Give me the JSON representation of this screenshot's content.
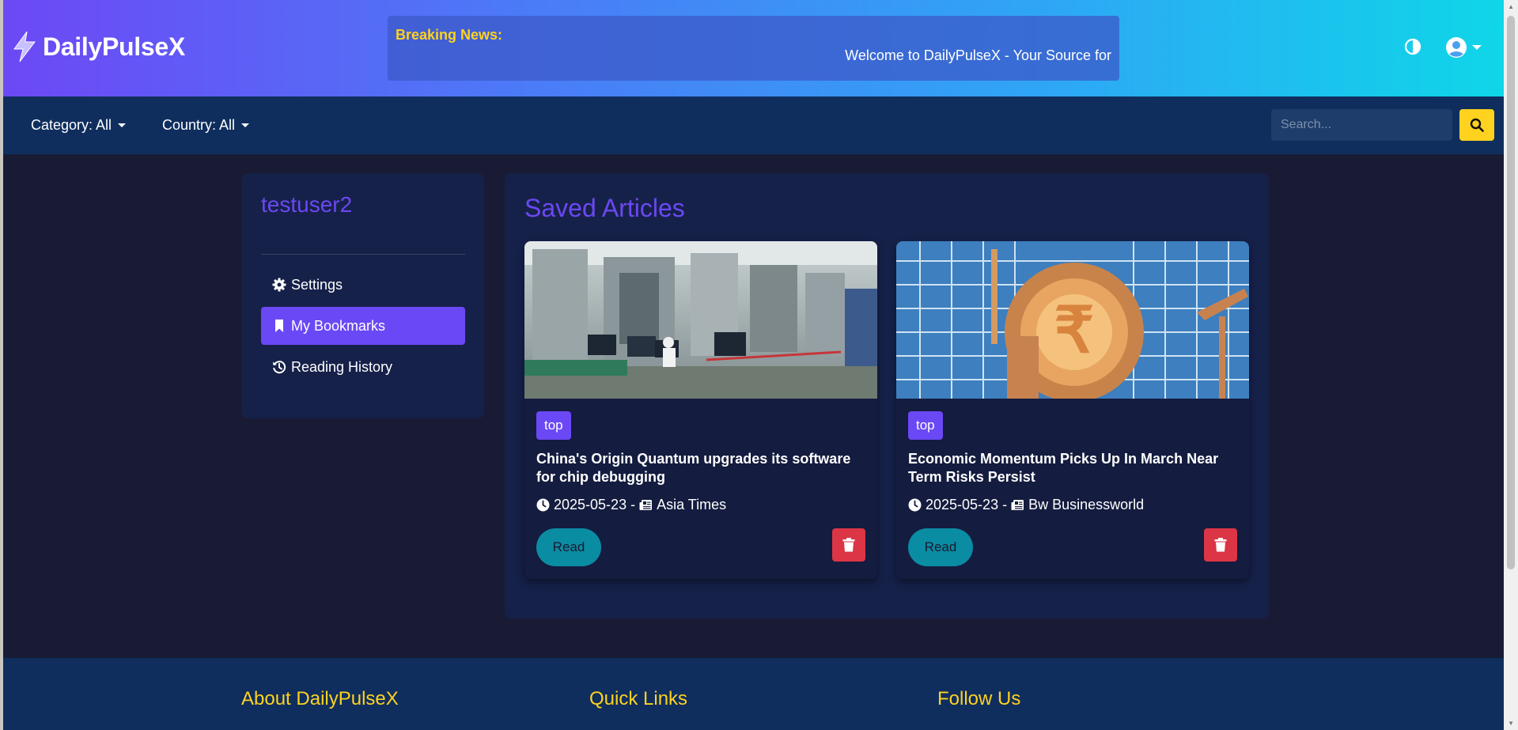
{
  "header": {
    "brand": "DailyPulseX",
    "ticker_label": "Breaking News:",
    "ticker_text": "Welcome to DailyPulseX - Your Source for"
  },
  "filters": {
    "category": "Category: All",
    "country": "Country: All",
    "search_placeholder": "Search..."
  },
  "sidebar": {
    "username": "testuser2",
    "email": "",
    "items": [
      {
        "label": "Settings",
        "icon": "gear-icon",
        "active": false
      },
      {
        "label": "My Bookmarks",
        "icon": "bookmark-icon",
        "active": true
      },
      {
        "label": "Reading History",
        "icon": "history-icon",
        "active": false
      }
    ]
  },
  "main": {
    "title": "Saved Articles",
    "articles": [
      {
        "category": "top",
        "title": "China's Origin Quantum upgrades its software for chip debugging",
        "date": "2025-05-23",
        "source": "Asia Times",
        "read_label": "Read"
      },
      {
        "category": "top",
        "title": "Economic Momentum Picks Up In March Near Term Risks Persist",
        "date": "2025-05-23",
        "source": "Bw Businessworld",
        "read_label": "Read"
      }
    ]
  },
  "footer": {
    "about": "About DailyPulseX",
    "quick_links": "Quick Links",
    "follow_us": "Follow Us"
  },
  "colors": {
    "accent_purple": "#6b48f5",
    "accent_yellow": "#ffd21f",
    "teal_button": "#0a8ca3",
    "danger": "#dc3545",
    "nav_blue": "#0f2e5e"
  }
}
